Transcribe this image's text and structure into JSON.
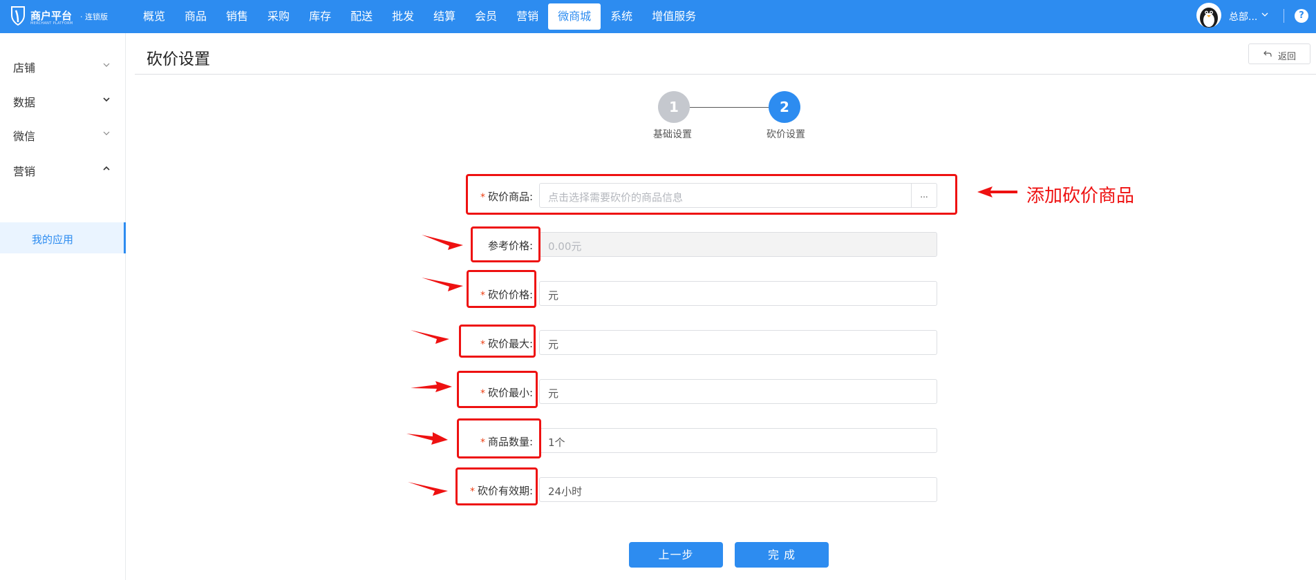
{
  "brand": {
    "title": "商户平台",
    "edition": "· 连锁版",
    "subtitle": "MERCHANT PLATFORM"
  },
  "nav": {
    "items": [
      {
        "label": "概览"
      },
      {
        "label": "商品"
      },
      {
        "label": "销售"
      },
      {
        "label": "采购"
      },
      {
        "label": "库存"
      },
      {
        "label": "配送"
      },
      {
        "label": "批发"
      },
      {
        "label": "结算"
      },
      {
        "label": "会员"
      },
      {
        "label": "营销"
      },
      {
        "label": "微商城",
        "active": true
      },
      {
        "label": "系统"
      },
      {
        "label": "增值服务"
      }
    ]
  },
  "user": {
    "name": "总部...",
    "help": "?"
  },
  "sidebar": {
    "items": [
      {
        "label": "店铺",
        "expanded": false
      },
      {
        "label": "数据",
        "expanded": false
      },
      {
        "label": "微信",
        "expanded": false
      },
      {
        "label": "营销",
        "expanded": true
      }
    ],
    "active_sub": "我的应用"
  },
  "page": {
    "title": "砍价设置",
    "back_label": "返回"
  },
  "steps": [
    {
      "number": "1",
      "label": "基础设置",
      "state": "done",
      "color": "#c5c8ce"
    },
    {
      "number": "2",
      "label": "砍价设置",
      "state": "current",
      "color": "#2d8cf0"
    }
  ],
  "form": {
    "product": {
      "label": "砍价商品:",
      "required": true,
      "placeholder": "点击选择需要砍价的商品信息",
      "picker_label": "..."
    },
    "ref_price": {
      "label": "参考价格:",
      "required": false,
      "value": "0.00元"
    },
    "bargain_price": {
      "label": "砍价价格:",
      "required": true,
      "value": "元"
    },
    "max_cut": {
      "label": "砍价最大:",
      "required": true,
      "value": "元"
    },
    "min_cut": {
      "label": "砍价最小:",
      "required": true,
      "value": "元"
    },
    "quantity": {
      "label": "商品数量:",
      "required": true,
      "value": "1个"
    },
    "validity": {
      "label": "砍价有效期:",
      "required": true,
      "value": "24小时"
    }
  },
  "annotation": {
    "text": "添加砍价商品",
    "color": "#ee1111"
  },
  "buttons": {
    "prev_label": "上一步",
    "finish_label": "完 成"
  },
  "colors": {
    "primary": "#2d8cf0",
    "required": "#ed3f14",
    "highlight": "#ee1111"
  }
}
